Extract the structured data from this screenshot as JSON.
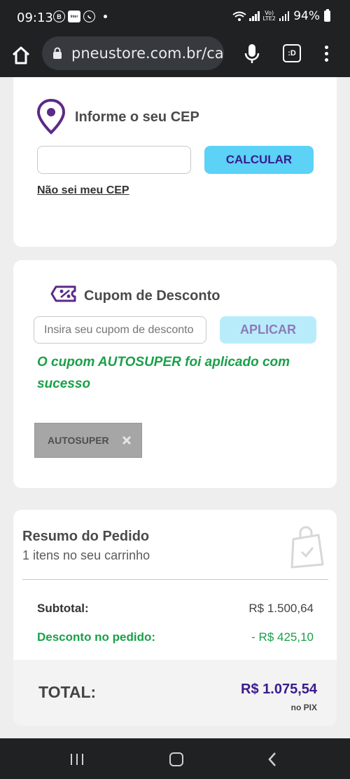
{
  "status_bar": {
    "time": "09:13",
    "app_icons": [
      "b-icon",
      "inter-icon",
      "whatsapp-icon"
    ],
    "app_icon_labels": {
      "b": "B",
      "inter": "Inter"
    },
    "network_label": "Vo) LTE2",
    "battery": "94%"
  },
  "browser": {
    "url": "pneustore.com.br/cart",
    "tabs_label": ":D"
  },
  "cep": {
    "title": "Informe o seu CEP",
    "input_value": "",
    "button": "CALCULAR",
    "link": "Não sei meu CEP"
  },
  "coupon": {
    "title": "Cupom de Desconto",
    "input_placeholder": "Insira seu cupom de desconto",
    "button": "APLICAR",
    "success_message": "O cupom AUTOSUPER foi aplicado com sucesso",
    "applied_code": "AUTOSUPER"
  },
  "summary": {
    "title": "Resumo do Pedido",
    "subtitle": "1 itens no seu carrinho",
    "subtotal_label": "Subtotal:",
    "subtotal_value": "R$ 1.500,64",
    "discount_label": "Desconto no pedido:",
    "discount_value": "- R$ 425,10",
    "total_label": "TOTAL:",
    "total_value": "R$ 1.075,54",
    "total_note": "no PIX"
  },
  "colors": {
    "brand_purple": "#3a1b8c",
    "button_cyan": "#5bd2f6",
    "success_green": "#1aa04a"
  }
}
